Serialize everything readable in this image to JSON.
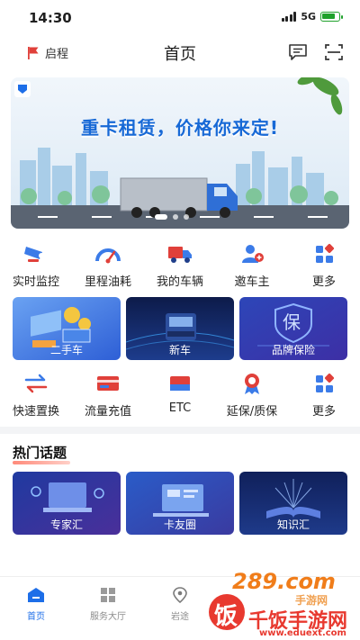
{
  "status_bar": {
    "time": "14:30",
    "network": "5G"
  },
  "nav": {
    "left_label": "启程",
    "title": "首页"
  },
  "banner": {
    "headline": "重卡租赁，价格你来定!"
  },
  "quick_row_1": [
    {
      "label": "实时监控",
      "icon": "camera-icon"
    },
    {
      "label": "里程油耗",
      "icon": "gauge-icon"
    },
    {
      "label": "我的车辆",
      "icon": "truck-icon"
    },
    {
      "label": "邀车主",
      "icon": "add-user-icon"
    },
    {
      "label": "更多",
      "icon": "grid-icon"
    }
  ],
  "cards": [
    {
      "label": "二手车"
    },
    {
      "label": "新车"
    },
    {
      "label": "品牌保险",
      "badge": "保"
    }
  ],
  "quick_row_2": [
    {
      "label": "快速置换",
      "icon": "swap-icon"
    },
    {
      "label": "流量充值",
      "icon": "card-icon"
    },
    {
      "label": "ETC",
      "icon": "etc-icon"
    },
    {
      "label": "延保/质保",
      "icon": "medal-icon"
    },
    {
      "label": "更多",
      "icon": "grid-icon"
    }
  ],
  "hot_topics": {
    "title": "热门话题",
    "items": [
      {
        "label": "专家汇"
      },
      {
        "label": "卡友圈"
      },
      {
        "label": "知识汇"
      }
    ]
  },
  "tabbar": [
    {
      "label": "首页",
      "icon": "home-icon",
      "active": true
    },
    {
      "label": "服务大厅",
      "icon": "grid-icon",
      "active": false
    },
    {
      "label": "岩途",
      "icon": "location-icon",
      "active": false
    },
    {
      "label": "",
      "icon": "",
      "active": false
    },
    {
      "label": "",
      "icon": "",
      "active": false
    }
  ],
  "watermark": {
    "line1": "289.com",
    "line2": "手游网",
    "line3": "千饭手游网",
    "line4": "www.eduext.com",
    "glyph": "饭"
  },
  "colors": {
    "accent": "#1d6ee8",
    "brand_red": "#e0403a",
    "watermark_orange": "#f07d1a"
  }
}
